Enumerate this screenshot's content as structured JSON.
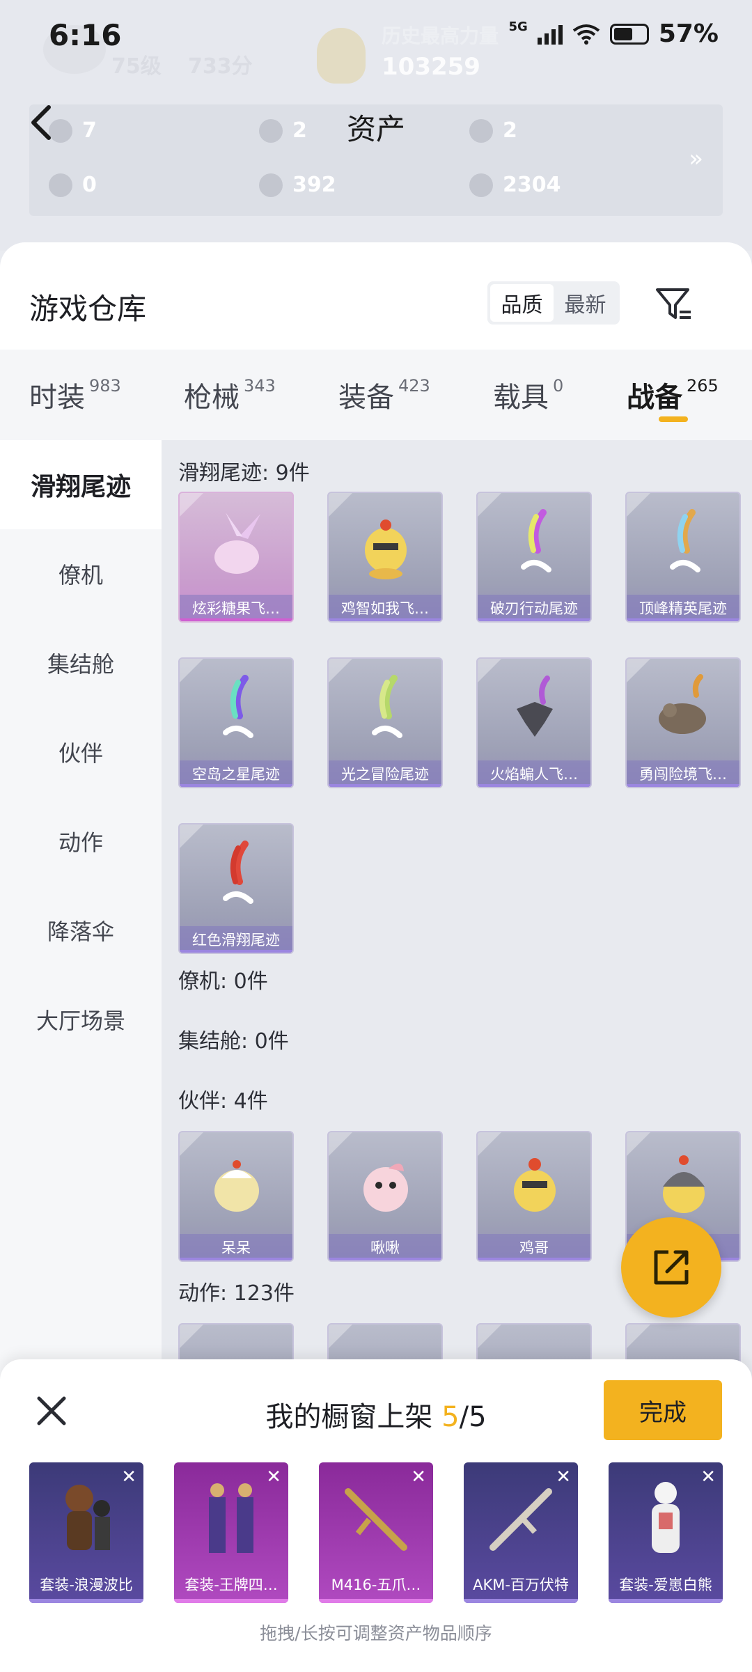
{
  "status_bar": {
    "time": "6:16",
    "network": "5G",
    "battery": "57%"
  },
  "profile_faded": {
    "level": "75级",
    "score": "733分",
    "power_label": "历史最高力量",
    "power_value": "103259"
  },
  "page": {
    "title": "资产"
  },
  "assets": [
    {
      "value": "7",
      "icon": "card-icon"
    },
    {
      "value": "2",
      "icon": "coin-icon"
    },
    {
      "value": "2",
      "icon": "coin-icon"
    },
    {
      "value": "0",
      "icon": "card-icon"
    },
    {
      "value": "392",
      "icon": "coin-icon"
    },
    {
      "value": "2304",
      "icon": "coin-icon"
    }
  ],
  "warehouse": {
    "title": "游戏仓库",
    "sort_options": [
      "品质",
      "最新"
    ],
    "sort_active": "品质"
  },
  "category_tabs": [
    {
      "label": "时装",
      "count": "983"
    },
    {
      "label": "枪械",
      "count": "343"
    },
    {
      "label": "装备",
      "count": "423"
    },
    {
      "label": "载具",
      "count": "0"
    },
    {
      "label": "战备",
      "count": "265",
      "active": true
    }
  ],
  "sidebar": [
    "滑翔尾迹",
    "僚机",
    "集结舱",
    "伙伴",
    "动作",
    "降落伞",
    "大厅场景"
  ],
  "sections": {
    "trail": {
      "title": "滑翔尾迹: 9件",
      "items": [
        "炫彩糖果飞…",
        "鸡智如我飞…",
        "破刃行动尾迹",
        "顶峰精英尾迹",
        "空岛之星尾迹",
        "光之冒险尾迹",
        "火焰蝙人飞…",
        "勇闯险境飞…",
        "红色滑翔尾迹"
      ]
    },
    "wingman": {
      "title": "僚机: 0件"
    },
    "pod": {
      "title": "集结舱: 0件"
    },
    "partner": {
      "title": "伙伴: 4件",
      "items": [
        "呆呆",
        "啾啾",
        "鸡哥",
        ""
      ]
    },
    "emote": {
      "title": "动作: 123件"
    }
  },
  "showcase": {
    "title_prefix": "我的橱窗上架",
    "count_current": "5",
    "count_total": "/5",
    "done_label": "完成",
    "items": [
      "套装-浪漫波比",
      "套装-王牌四…",
      "M416-五爪…",
      "AKM-百万伏特",
      "套装-爱崽白熊"
    ],
    "hint": "拖拽/长按可调整资产物品顺序"
  },
  "colors": {
    "accent": "#f3b21f",
    "epic_purple": "#9b86e0",
    "legend_pink": "#cf60d2"
  }
}
